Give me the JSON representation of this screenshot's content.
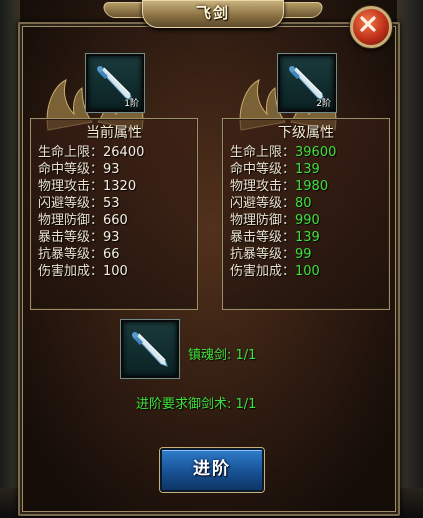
{
  "window": {
    "title": "飞剑"
  },
  "current_item": {
    "level_label": "1阶"
  },
  "next_item": {
    "level_label": "2阶"
  },
  "current_stats": {
    "title": "当前属性",
    "rows": [
      {
        "label": "生命上限：",
        "value": "26400"
      },
      {
        "label": "命中等级：",
        "value": "93"
      },
      {
        "label": "物理攻击：",
        "value": "1320"
      },
      {
        "label": "闪避等级：",
        "value": "53"
      },
      {
        "label": "物理防御：",
        "value": "660"
      },
      {
        "label": "暴击等级：",
        "value": "93"
      },
      {
        "label": "抗暴等级：",
        "value": "66"
      },
      {
        "label": "伤害加成：",
        "value": "100"
      }
    ]
  },
  "next_stats": {
    "title": "下级属性",
    "rows": [
      {
        "label": "生命上限：",
        "value": "39600"
      },
      {
        "label": "命中等级：",
        "value": "139"
      },
      {
        "label": "物理攻击：",
        "value": "1980"
      },
      {
        "label": "闪避等级：",
        "value": "80"
      },
      {
        "label": "物理防御：",
        "value": "990"
      },
      {
        "label": "暴击等级：",
        "value": "139"
      },
      {
        "label": "抗暴等级：",
        "value": "99"
      },
      {
        "label": "伤害加成：",
        "value": "100"
      }
    ]
  },
  "material": {
    "label": "镇魂剑: 1/1",
    "requirement": "进阶要求御剑术: 1/1"
  },
  "actions": {
    "advance_label": "进阶"
  },
  "colors": {
    "stat_green": "#3de03d",
    "button_blue": "#1a5599",
    "close_red": "#c0301a",
    "frame_gold": "#a08c66"
  },
  "icons": {
    "item": "flying-sword-icon",
    "close": "close-x-icon"
  }
}
